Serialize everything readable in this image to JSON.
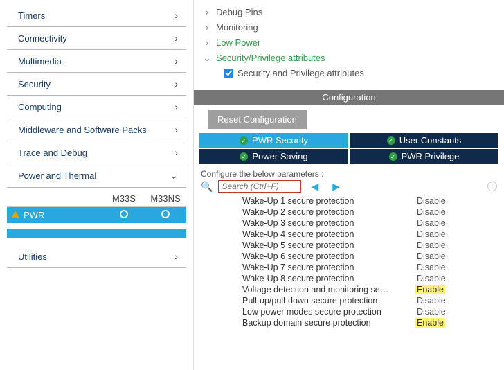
{
  "left": {
    "categories": [
      {
        "label": "Timers",
        "expanded": false
      },
      {
        "label": "Connectivity",
        "expanded": false
      },
      {
        "label": "Multimedia",
        "expanded": false
      },
      {
        "label": "Security",
        "expanded": false
      },
      {
        "label": "Computing",
        "expanded": false
      },
      {
        "label": "Middleware and Software Packs",
        "expanded": false
      },
      {
        "label": "Trace and Debug",
        "expanded": false
      },
      {
        "label": "Power and Thermal",
        "expanded": true
      },
      {
        "label": "Utilities",
        "expanded": false
      }
    ],
    "sub_header": {
      "c1": "M33S",
      "c2": "M33NS"
    },
    "sub_row_label": "PWR"
  },
  "tree": {
    "items": [
      {
        "label": "Debug Pins",
        "expanded": false,
        "green": false
      },
      {
        "label": "Monitoring",
        "expanded": false,
        "green": false
      },
      {
        "label": "Low Power",
        "expanded": false,
        "green": true
      },
      {
        "label": "Security/Privilege attributes",
        "expanded": true,
        "green": true,
        "child": {
          "checked": true,
          "label": "Security and Privilege attributes"
        }
      }
    ]
  },
  "config_title": "Configuration",
  "reset_btn": "Reset Configuration",
  "tabs": [
    {
      "label": "PWR Security",
      "active": true
    },
    {
      "label": "User Constants",
      "active": false
    },
    {
      "label": "Power Saving",
      "active": false
    },
    {
      "label": "PWR Privilege",
      "active": false
    }
  ],
  "params_title": "Configure the below parameters :",
  "search_placeholder": "Search (Ctrl+F)",
  "params": [
    {
      "name": "Wake-Up 1 secure protection",
      "value": "Disable",
      "highlight": false
    },
    {
      "name": "Wake-Up 2 secure protection",
      "value": "Disable",
      "highlight": false
    },
    {
      "name": "Wake-Up 3 secure protection",
      "value": "Disable",
      "highlight": false
    },
    {
      "name": "Wake-Up 4 secure protection",
      "value": "Disable",
      "highlight": false
    },
    {
      "name": "Wake-Up 5 secure protection",
      "value": "Disable",
      "highlight": false
    },
    {
      "name": "Wake-Up 6 secure protection",
      "value": "Disable",
      "highlight": false
    },
    {
      "name": "Wake-Up 7 secure protection",
      "value": "Disable",
      "highlight": false
    },
    {
      "name": "Wake-Up 8 secure protection",
      "value": "Disable",
      "highlight": false
    },
    {
      "name": "Voltage detection and monitoring se…",
      "value": "Enable",
      "highlight": true
    },
    {
      "name": "Pull-up/pull-down secure protection",
      "value": "Disable",
      "highlight": false
    },
    {
      "name": "Low power modes secure protection",
      "value": "Disable",
      "highlight": false
    },
    {
      "name": "Backup domain secure protection",
      "value": "Enable",
      "highlight": true
    }
  ]
}
